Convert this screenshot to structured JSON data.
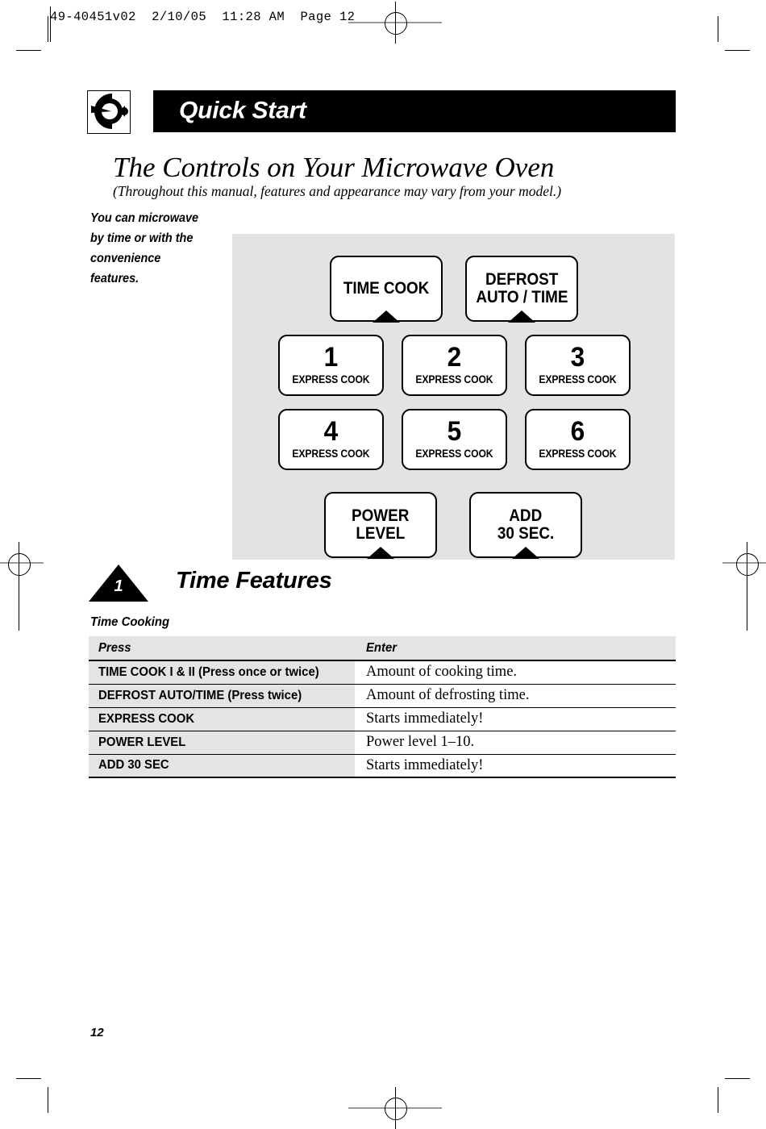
{
  "printer": {
    "slug": "49-40451v02  2/10/05  11:28 AM  Page 12"
  },
  "header": {
    "banner_title": "Quick Start",
    "knob_icon": "microwave-knob-icon"
  },
  "heading": {
    "title": "The Controls on Your Microwave Oven",
    "subtitle": "(Throughout this manual, features and appearance may vary from your model.)"
  },
  "side_note": {
    "text": "You can microwave by time or with the convenience features."
  },
  "panel": {
    "background": "#e3e3e3",
    "rows": [
      {
        "buttons": [
          {
            "type": "wide",
            "lines": [
              "TIME COOK"
            ],
            "notch": true,
            "name": "time-cook-button"
          },
          {
            "type": "wide",
            "lines": [
              "DEFROST",
              "AUTO / TIME"
            ],
            "notch": true,
            "name": "defrost-auto-time-button"
          }
        ]
      },
      {
        "buttons": [
          {
            "type": "num",
            "number": "1",
            "sub": "EXPRESS COOK",
            "notch": false,
            "name": "express-cook-1-button"
          },
          {
            "type": "num",
            "number": "2",
            "sub": "EXPRESS COOK",
            "notch": false,
            "name": "express-cook-2-button"
          },
          {
            "type": "num",
            "number": "3",
            "sub": "EXPRESS COOK",
            "notch": false,
            "name": "express-cook-3-button"
          }
        ]
      },
      {
        "buttons": [
          {
            "type": "num",
            "number": "4",
            "sub": "EXPRESS COOK",
            "notch": false,
            "name": "express-cook-4-button"
          },
          {
            "type": "num",
            "number": "5",
            "sub": "EXPRESS COOK",
            "notch": false,
            "name": "express-cook-5-button"
          },
          {
            "type": "num",
            "number": "6",
            "sub": "EXPRESS COOK",
            "notch": false,
            "name": "express-cook-6-button"
          }
        ]
      },
      {
        "buttons": [
          {
            "type": "wide",
            "lines": [
              "POWER",
              "LEVEL"
            ],
            "notch": true,
            "name": "power-level-button"
          },
          {
            "type": "wide",
            "lines": [
              "ADD",
              "30 SEC."
            ],
            "notch": true,
            "name": "add-30-sec-button"
          }
        ]
      }
    ]
  },
  "step": {
    "number": "1",
    "title": "Time Features",
    "subheading": "Time Cooking"
  },
  "table": {
    "columns": [
      "Press",
      "Enter"
    ],
    "rows": [
      {
        "press": "TIME COOK I & II (Press once or twice)",
        "enter": "Amount of cooking time."
      },
      {
        "press": "DEFROST AUTO/TIME (Press twice)",
        "enter": "Amount of defrosting time."
      },
      {
        "press": "EXPRESS COOK",
        "enter": "Starts immediately!"
      },
      {
        "press": "POWER LEVEL",
        "enter": "Power level 1–10."
      },
      {
        "press": "ADD 30 SEC",
        "enter": "Starts immediately!"
      }
    ]
  },
  "footer": {
    "page_number": "12"
  }
}
